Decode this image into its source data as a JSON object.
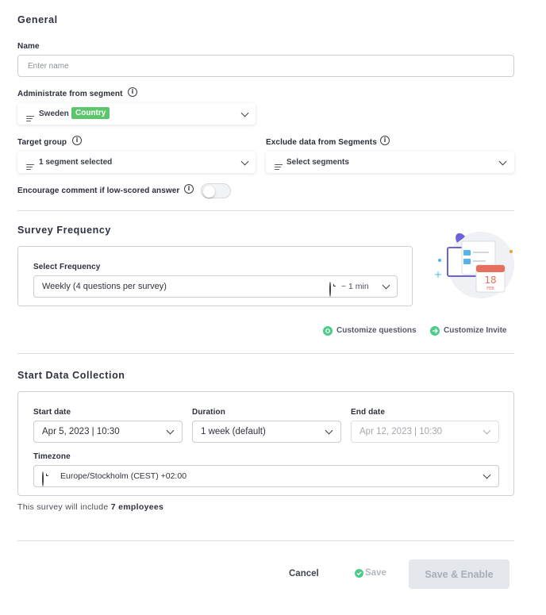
{
  "general": {
    "title": "General",
    "name_label": "Name",
    "name_placeholder": "Enter name",
    "segment_label": "Administrate from segment",
    "segment_value": "Sweden",
    "segment_badge": "Country",
    "target_label": "Target group",
    "target_value": "1 segment selected",
    "exclude_label": "Exclude data from Segments",
    "exclude_value": "Select segments",
    "encourage_label": "Encourage comment if low-scored answer",
    "encourage_enabled": false,
    "info_glyph": "i"
  },
  "frequency": {
    "title": "Survey Frequency",
    "select_label": "Select Frequency",
    "select_value": "Weekly (4 questions per survey)",
    "duration_hint": "~ 1 min",
    "illustration_day": "18",
    "illustration_month": "FEB",
    "customize_questions": "Customize questions",
    "customize_invite": "Customize Invite"
  },
  "collection": {
    "title": "Start Data Collection",
    "start_label": "Start date",
    "start_value": "Apr 5, 2023 | 10:30",
    "duration_label": "Duration",
    "duration_value": "1 week (default)",
    "end_label": "End date",
    "end_value": "Apr 12, 2023 | 10:30",
    "timezone_label": "Timezone",
    "timezone_value": "Europe/Stockholm (CEST) +02:00",
    "summary_prefix": "This survey will include ",
    "summary_count": "7 employees"
  },
  "footer": {
    "cancel": "Cancel",
    "save": "Save",
    "save_enable": "Save & Enable"
  },
  "colors": {
    "badge_green": "#5cc66c",
    "link_green": "#4ecb8a",
    "disabled_button": "#e4e7ec"
  },
  "icons": [
    "info-icon",
    "lines-icon",
    "chevron-down-icon",
    "clock-icon",
    "check-circle-icon",
    "settings-icon",
    "arrow-right-icon"
  ]
}
